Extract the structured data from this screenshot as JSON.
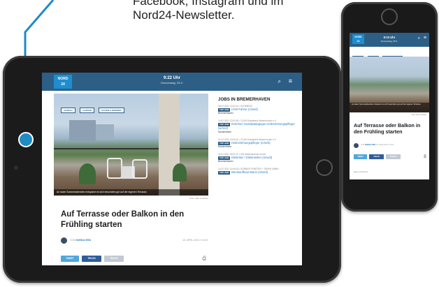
{
  "caption": {
    "line1": "Facebook, Instagram und im",
    "line2": "Nord24-Newsletter."
  },
  "tablet": {
    "logo_top": "NORD",
    "logo_bottom": "24",
    "time": "9:22 Uhr",
    "date": "Donnerstag, 25.3.",
    "search_icon": "⌕",
    "menu_icon": "≡",
    "chips": [
      "AUSBAU",
      "GARTEN",
      "BAUEN & WOHNEN"
    ],
    "photo_caption": "An lauen Sommerabenden entspannt es sich besonders gut auf der eigenen Terrasse.",
    "credit": "Foto: Idee & Aufbau",
    "headline": "Auf Terrasse oder Balkon in den Frühling starten",
    "author_prefix": "VON",
    "author_name": "NORD24 RED",
    "article_date": "15. APRIL 2020 // 13:00",
    "share_twitter": "TWEET",
    "share_facebook": "TEILEN",
    "share_mail": "TEILEN",
    "print_icon": "⎙",
    "jobs_title": "JOBS IN BREMERHAVEN",
    "tag_label": "TOP JOB",
    "jobs": [
      {
        "meta": "06.02.2021 13:02:41 • SCHMIEDE",
        "title": "LKW-Fahrer (m/w/d)",
        "location": "Bremerhaven"
      },
      {
        "meta": "14.02.2021 13:00:50 • CVJM-Sozialwerk Wesermünde e.V.",
        "title": "Erzieher/ Sozialpädagoge/ Heilerziehungspfleger (w/m/d)",
        "location": "Nordenham"
      },
      {
        "meta": "21.02.2021 13:00:41 • CVJM-Sozialwerk Wesermünde e.V.",
        "title": "Heilerziehungspfleger (m/w/d)",
        "location": "Nordenham"
      },
      {
        "meta": "30.01.2021 09:01:47 • ISA Elektrotechnik GmbH",
        "title": "Elektriker / Elektroniker (m/w/d)",
        "location": "Bremerhaven"
      },
      {
        "meta": "14.02.2021 13:05:33 • KORNER FENSTER + TÜREN GMBH",
        "title": "Bürokauffrau/-Mann (m/w/d)",
        "location": ""
      }
    ]
  },
  "phone": {
    "logo_top": "NORD",
    "logo_bottom": "24",
    "time": "9:10 Uhr",
    "date": "Donnerstag, 25.3.",
    "search_icon": "⌕",
    "menu_icon": "≡",
    "chips": [
      "AUSBAU",
      "GARTEN",
      "BAUEN & WOHNEN"
    ],
    "photo_caption": "An lauen Sommerabenden entspannt es sich besonders gut auf der eigenen Terrasse.",
    "credit": "Foto: Idee & Aufbau",
    "headline": "Auf Terrasse oder Balkon in den Frühling starten",
    "author_prefix": "VON",
    "author_name": "NORD24 RED",
    "article_date": "15. APRIL 2020 // 13:00",
    "share_twitter": "TWEET",
    "share_facebook": "TEILEN",
    "share_mail": "TEILEN",
    "print_icon": "⎙",
    "footer_text": "Bauen & Wohnen"
  },
  "colors": {
    "header": "#2d5f86",
    "accent": "#1f8ecf",
    "pointer": "#1e8bc3"
  }
}
